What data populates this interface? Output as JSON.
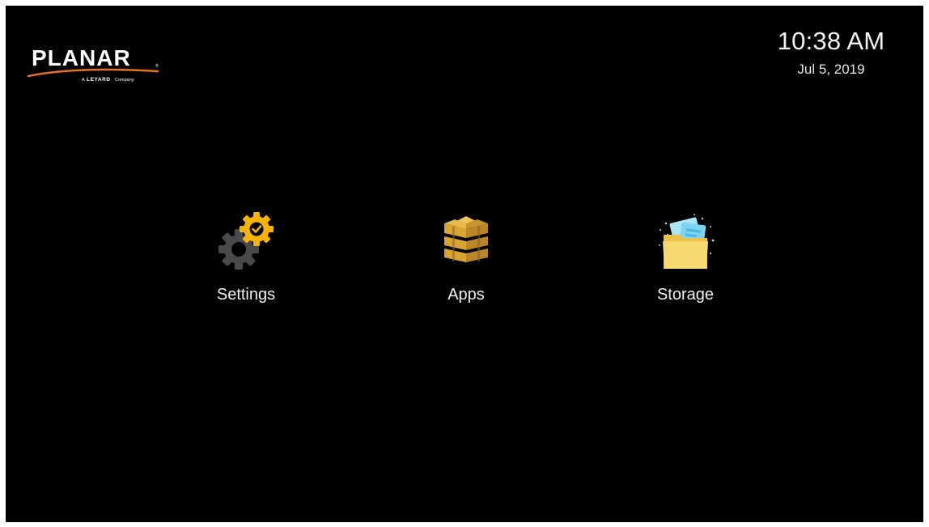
{
  "brand": {
    "name": "PLANAR",
    "tagline_prefix": "A",
    "tagline_brand": "LEYARD",
    "tagline_suffix": "Company",
    "accent_color": "#e8731a"
  },
  "clock": {
    "time": "10:38 AM",
    "date": "Jul 5, 2019"
  },
  "tiles": [
    {
      "label": "Settings",
      "icon": "settings-gear-icon"
    },
    {
      "label": "Apps",
      "icon": "apps-stack-icon"
    },
    {
      "label": "Storage",
      "icon": "storage-folder-icon"
    }
  ],
  "colors": {
    "background": "#000000",
    "text": "#f0f0f0",
    "gear_gray": "#4a4a4a",
    "badge_yellow": "#f5b400",
    "apps_gold": "#d9a432",
    "folder_yellow": "#f6da6f",
    "paper_blue": "#7fd3f2"
  }
}
